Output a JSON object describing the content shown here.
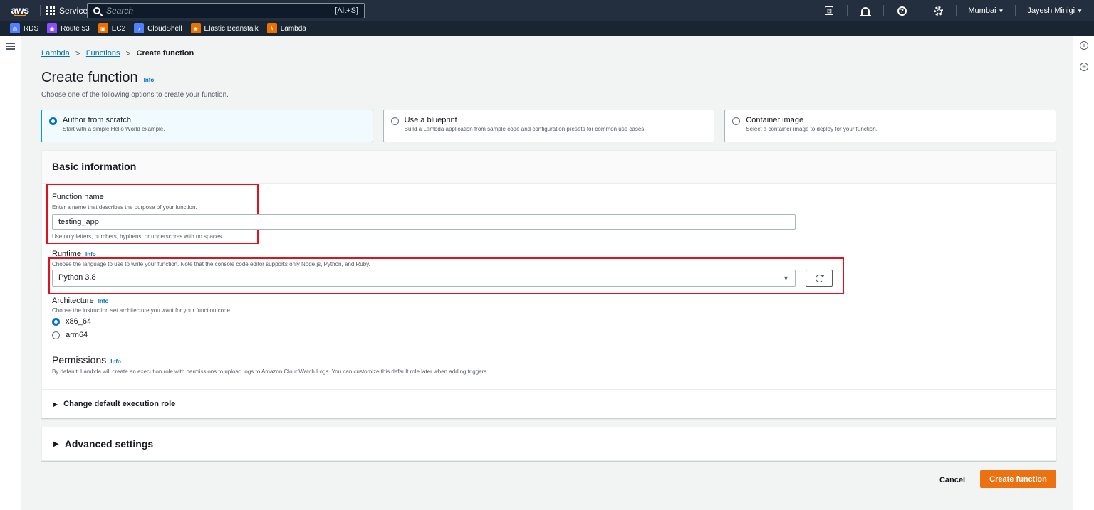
{
  "topnav": {
    "logo": "aws",
    "services_label": "Services",
    "search_placeholder": "Search",
    "search_shortcut": "[Alt+S]",
    "cloudshell_glyph": "⊡",
    "help_glyph": "?",
    "region": "Mumbai",
    "user": "Jayesh Minigi"
  },
  "favorites": [
    {
      "label": "RDS",
      "color": "#527fff",
      "icon": "rds-icon"
    },
    {
      "label": "Route 53",
      "color": "#8c4fff",
      "icon": "route53-icon"
    },
    {
      "label": "EC2",
      "color": "#ed7100",
      "icon": "ec2-icon"
    },
    {
      "label": "CloudShell",
      "color": "#527fff",
      "icon": "cloudshell-icon"
    },
    {
      "label": "Elastic Beanstalk",
      "color": "#ed7100",
      "icon": "beanstalk-icon"
    },
    {
      "label": "Lambda",
      "color": "#ed7100",
      "icon": "lambda-icon"
    }
  ],
  "breadcrumb": {
    "lambda": "Lambda",
    "functions": "Functions",
    "current": "Create function",
    "separator": ">"
  },
  "page": {
    "title": "Create function",
    "info": "Info",
    "description": "Choose one of the following options to create your function."
  },
  "options": [
    {
      "title": "Author from scratch",
      "desc": "Start with a simple Hello World example.",
      "selected": true
    },
    {
      "title": "Use a blueprint",
      "desc": "Build a Lambda application from sample code and configuration presets for common use cases.",
      "selected": false
    },
    {
      "title": "Container image",
      "desc": "Select a container image to deploy for your function.",
      "selected": false
    }
  ],
  "basic": {
    "heading": "Basic information",
    "function_name": {
      "label": "Function name",
      "desc": "Enter a name that describes the purpose of your function.",
      "value": "testing_app",
      "constraint": "Use only letters, numbers, hyphens, or underscores with no spaces."
    },
    "runtime": {
      "label": "Runtime",
      "info": "Info",
      "desc": "Choose the language to use to write your function. Note that the console code editor supports only Node.js, Python, and Ruby.",
      "value": "Python 3.8"
    },
    "architecture": {
      "label": "Architecture",
      "info": "Info",
      "desc": "Choose the instruction set architecture you want for your function code.",
      "options": [
        "x86_64",
        "arm64"
      ],
      "selected": "x86_64"
    },
    "permissions": {
      "title": "Permissions",
      "info": "Info",
      "desc": "By default, Lambda will create an execution role with permissions to upload logs to Amazon CloudWatch Logs. You can customize this default role later when adding triggers."
    },
    "change_role": "Change default execution role"
  },
  "advanced": "Advanced settings",
  "actions": {
    "cancel": "Cancel",
    "create": "Create function"
  },
  "colors": {
    "accent": "#0073bb",
    "primary_button": "#ec7211",
    "highlight": "#e3101d",
    "nav_bg": "#232f3e"
  }
}
